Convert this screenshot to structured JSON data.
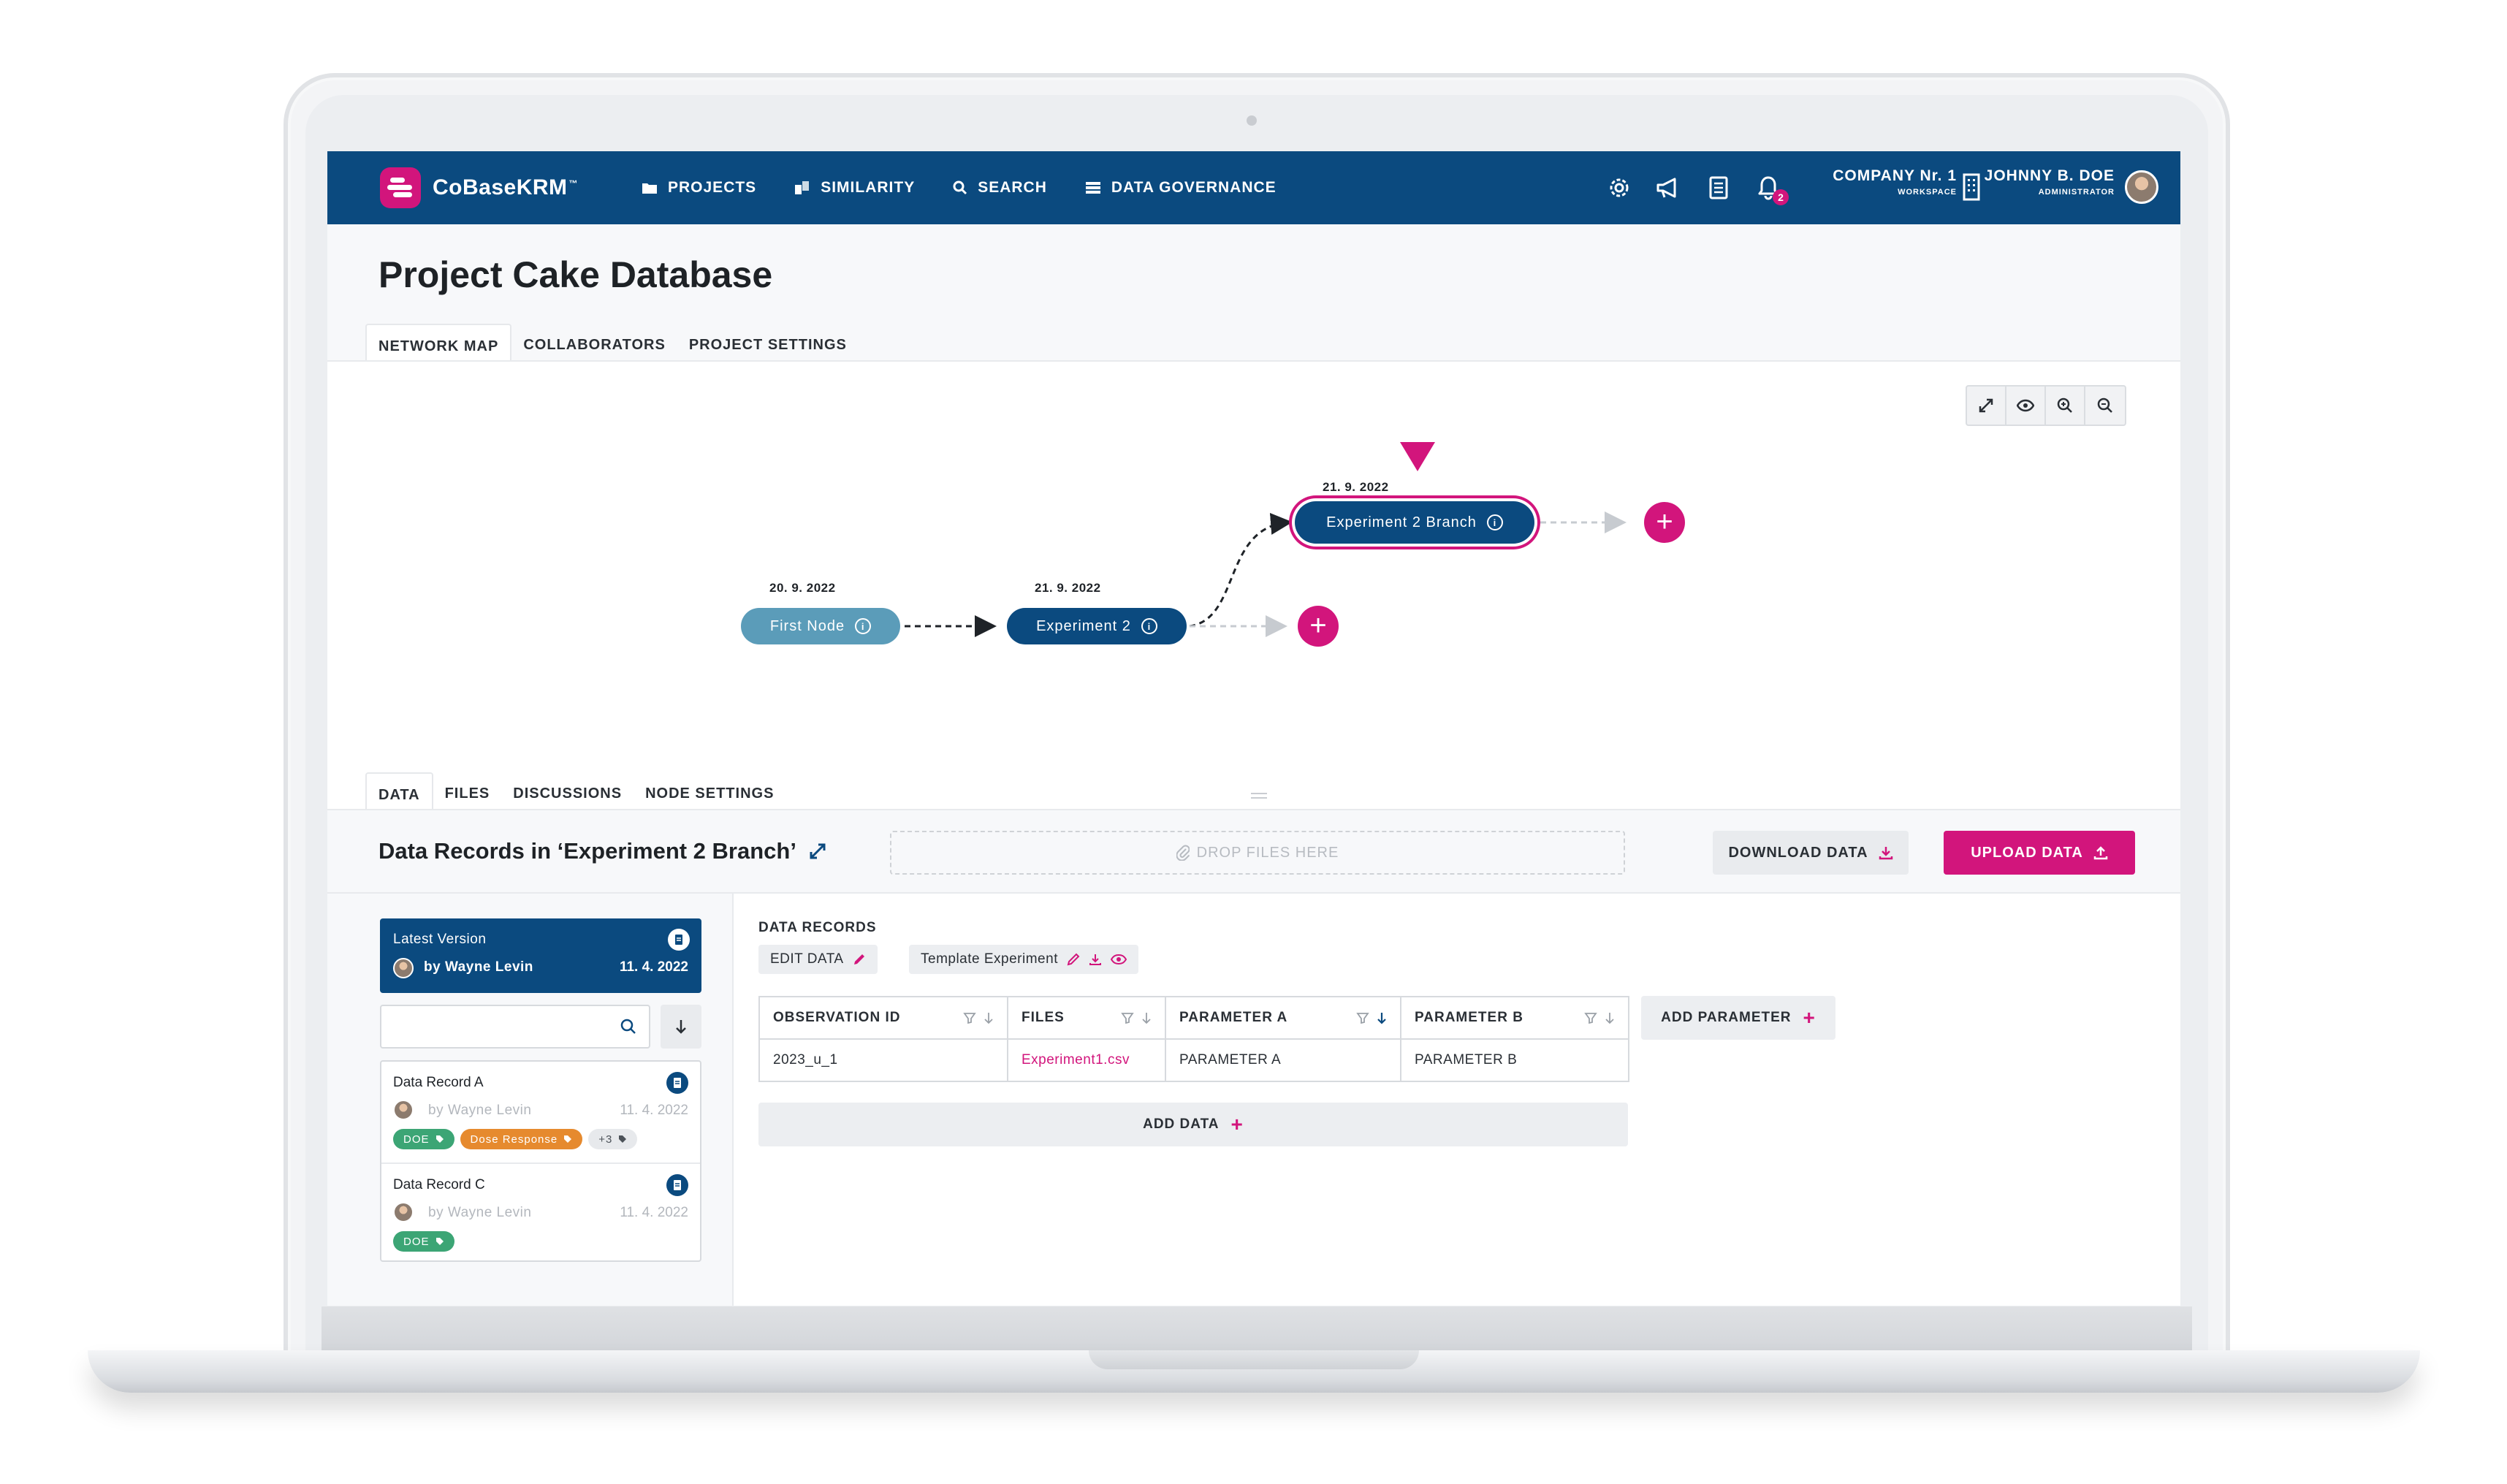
{
  "app": {
    "logo_name": "CoBaseKRM",
    "logo_tm": "™"
  },
  "nav": {
    "items": [
      {
        "label": "PROJECTS",
        "icon": "folder-icon"
      },
      {
        "label": "SIMILARITY",
        "icon": "similarity-icon"
      },
      {
        "label": "SEARCH",
        "icon": "search-icon"
      },
      {
        "label": "DATA GOVERNANCE",
        "icon": "stack-icon"
      }
    ]
  },
  "toolbar": {
    "icons": [
      "gear-icon",
      "megaphone-icon",
      "book-icon",
      "bell-icon"
    ],
    "notification_count": "2"
  },
  "workspace": {
    "name": "COMPANY Nr. 1",
    "label": "WORKSPACE"
  },
  "user": {
    "name": "JOHNNY B. DOE",
    "role": "ADMINISTRATOR"
  },
  "page": {
    "title": "Project Cake Database"
  },
  "project_tabs": [
    "NETWORK MAP",
    "COLLABORATORS",
    "PROJECT SETTINGS"
  ],
  "map_tools": [
    "expand-icon",
    "eye-icon",
    "zoom-in-icon",
    "zoom-out-icon"
  ],
  "network": {
    "nodes": [
      {
        "label": "First Node",
        "date": "20. 9. 2022",
        "color": "#5b9cb9"
      },
      {
        "label": "Experiment 2",
        "date": "21. 9. 2022",
        "color": "#0b4a7f"
      },
      {
        "label": "Experiment 2 Branch",
        "date": "21. 9. 2022",
        "color": "#0b4a7f",
        "selected": true
      }
    ],
    "add_symbol": "+"
  },
  "node_tabs": [
    "DATA",
    "FILES",
    "DISCUSSIONS",
    "NODE SETTINGS"
  ],
  "records": {
    "title": "Data Records in ‘Experiment 2 Branch’",
    "dropzone": "DROP FILES HERE",
    "download_label": "DOWNLOAD DATA",
    "upload_label": "UPLOAD DATA"
  },
  "latest_version": {
    "title": "Latest Version",
    "by": "by Wayne Levin",
    "date": "11. 4. 2022"
  },
  "record_list": [
    {
      "name": "Data Record A",
      "by": "by Wayne Levin",
      "date": "11. 4. 2022",
      "tags": [
        "DOE",
        "Dose Response",
        "+3"
      ]
    },
    {
      "name": "Data Record C",
      "by": "by Wayne Levin",
      "date": "11. 4. 2022",
      "tags": [
        "DOE"
      ]
    }
  ],
  "data_records": {
    "label": "DATA RECORDS",
    "edit_label": "EDIT DATA",
    "template_label": "Template Experiment",
    "columns": [
      "OBSERVATION ID",
      "FILES",
      "PARAMETER A",
      "PARAMETER B"
    ],
    "rows": [
      [
        "2023_u_1",
        "Experiment1.csv",
        "PARAMETER A",
        "PARAMETER B"
      ]
    ],
    "add_parameter_label": "ADD PARAMETER",
    "add_data_label": "ADD DATA"
  },
  "colors": {
    "brand_blue": "#0b4a7f",
    "accent_pink": "#d2157c",
    "tag_green": "#3ca575",
    "tag_orange": "#e68a2e"
  }
}
